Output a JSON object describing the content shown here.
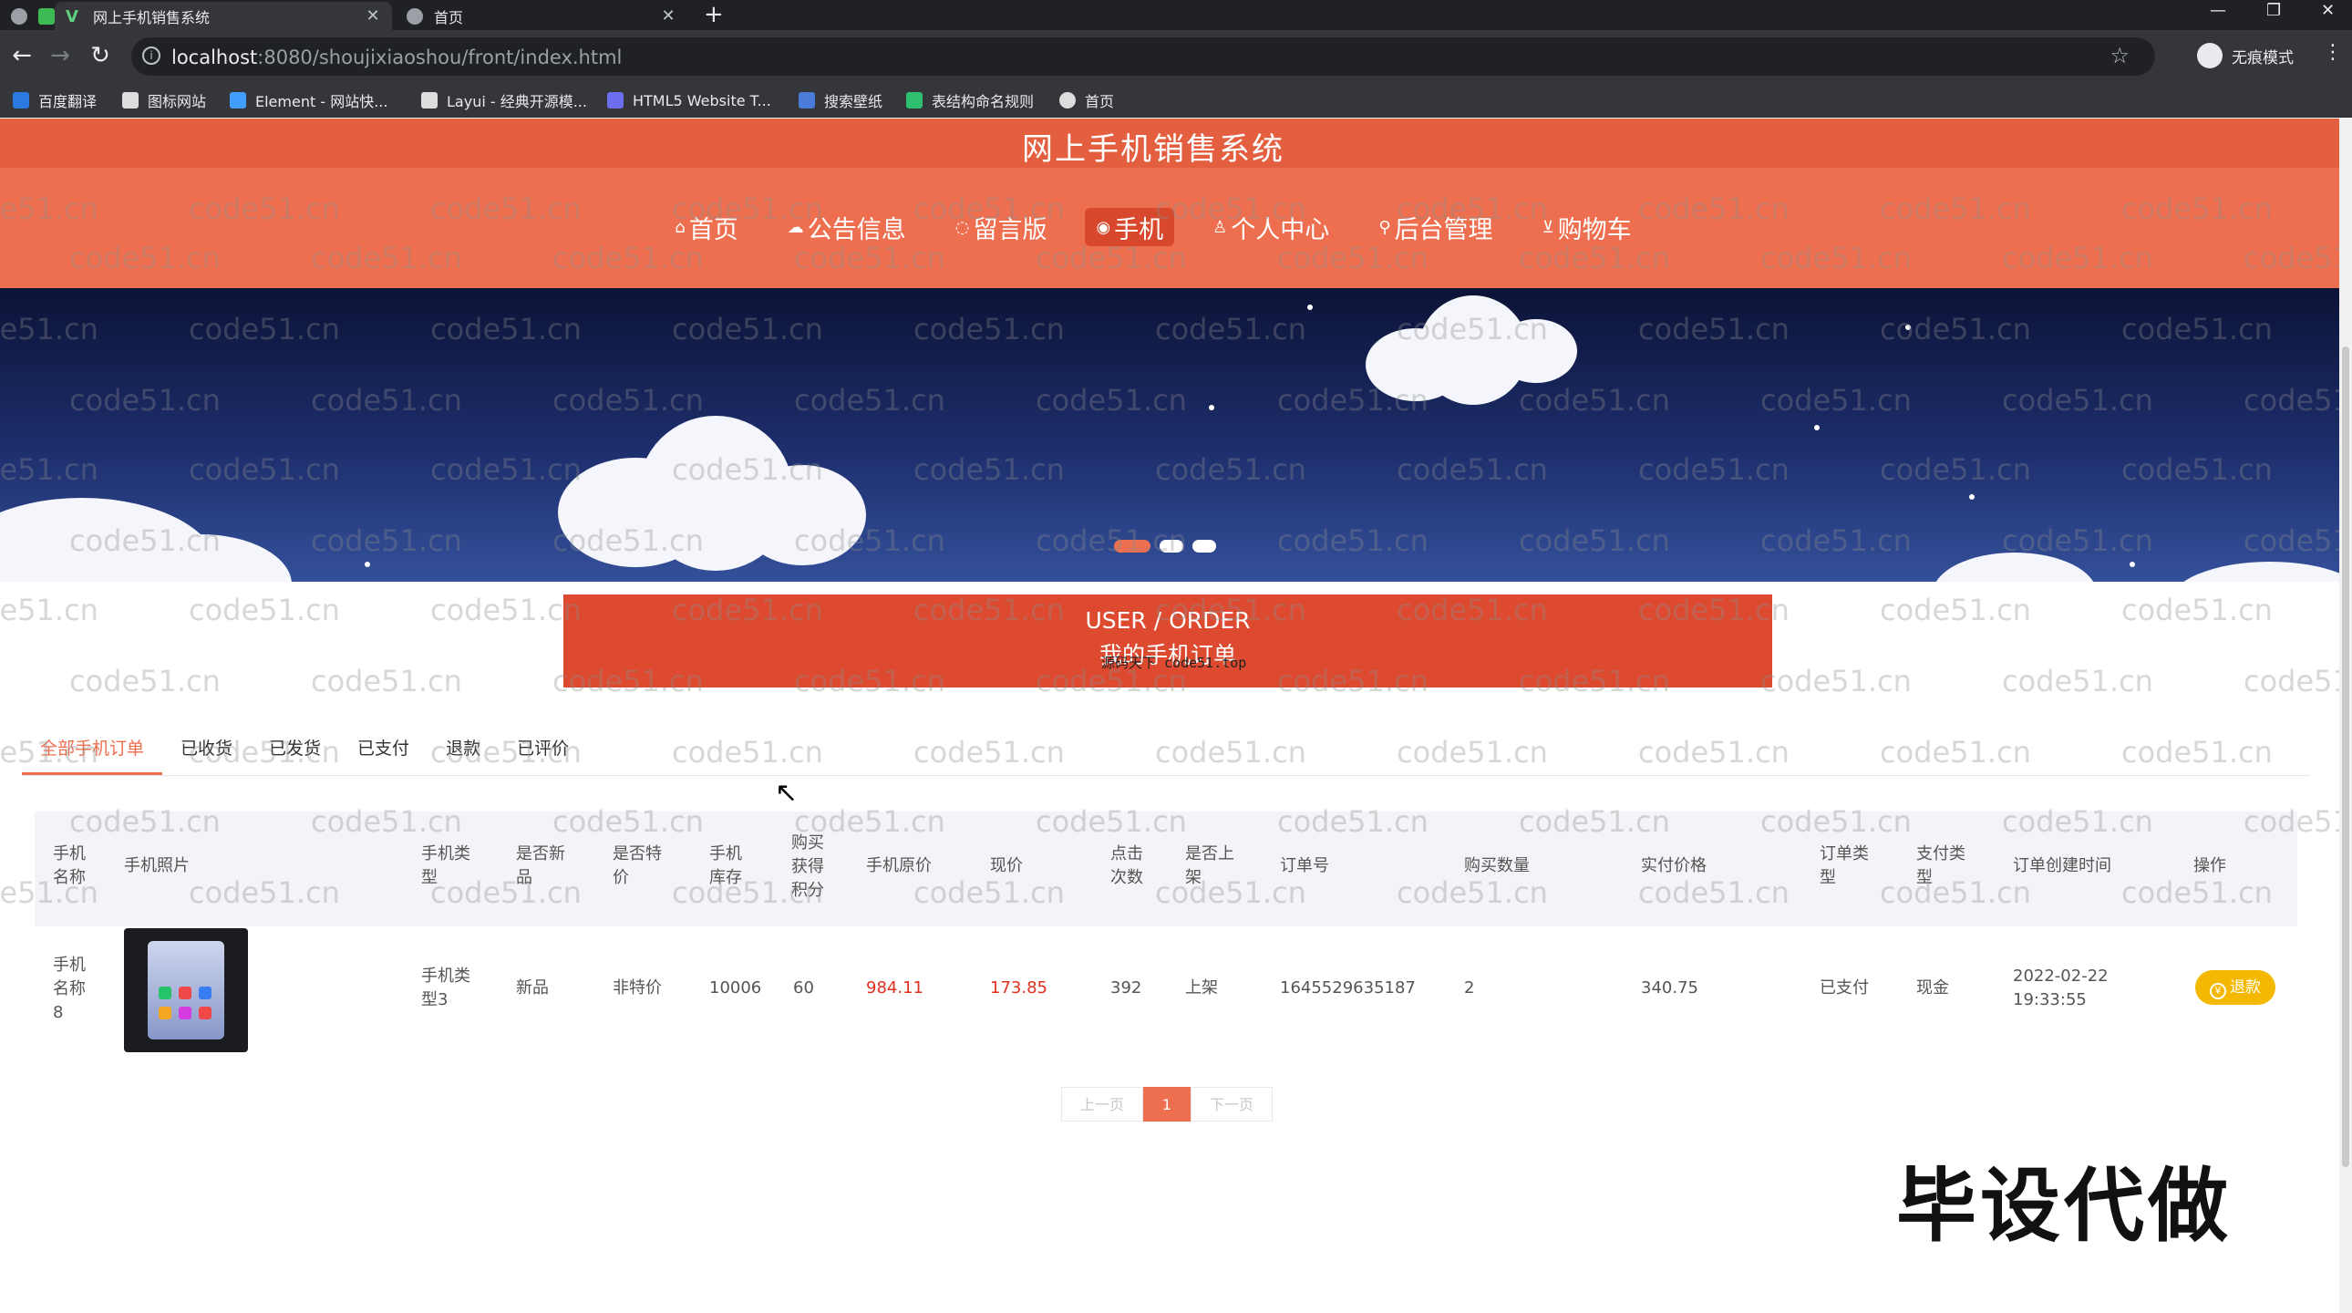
{
  "browser": {
    "tabs": [
      {
        "title": "网上手机销售系统"
      },
      {
        "title": "首页"
      }
    ],
    "url_host": "localhost",
    "url_rest": ":8080/shoujixiaoshou/front/index.html",
    "profile_label": "无痕模式",
    "bookmarks": [
      {
        "label": "百度翻译",
        "color": "#2a7ae2"
      },
      {
        "label": "图标网站",
        "color": "#dddddd"
      },
      {
        "label": "Element - 网站快...",
        "color": "#409eff"
      },
      {
        "label": "Layui - 经典开源模...",
        "color": "#dddddd"
      },
      {
        "label": "HTML5 Website T...",
        "color": "#6d6df0"
      },
      {
        "label": "搜索壁纸",
        "color": "#4a7bd8"
      },
      {
        "label": "表结构命名规则",
        "color": "#2fbf71"
      },
      {
        "label": "首页",
        "color": "#dddddd"
      }
    ]
  },
  "site": {
    "title": "网上手机销售系统",
    "nav": [
      {
        "label": "首页",
        "icon": "home-icon",
        "glyph": "⌂"
      },
      {
        "label": "公告信息",
        "icon": "notice-icon",
        "glyph": "☁"
      },
      {
        "label": "留言版",
        "icon": "message-icon",
        "glyph": "◌"
      },
      {
        "label": "手机",
        "icon": "phone-icon",
        "glyph": "◉",
        "active": true
      },
      {
        "label": "个人中心",
        "icon": "user-icon",
        "glyph": "♙"
      },
      {
        "label": "后台管理",
        "icon": "link-icon",
        "glyph": "⚲"
      },
      {
        "label": "购物车",
        "icon": "cart-icon",
        "glyph": "⊻"
      }
    ],
    "accent": "#ee6f4f"
  },
  "order": {
    "heading_en": "USER / ORDER",
    "heading_cn": "我的手机订单",
    "watermark_small": "源码天下 code51.top",
    "tabs": [
      "全部手机订单",
      "已收货",
      "已发货",
      "已支付",
      "退款",
      "已评价"
    ],
    "columns": [
      "手机名称",
      "手机照片",
      "手机类型",
      "是否新品",
      "是否特价",
      "手机库存",
      "购买获得积分",
      "手机原价",
      "现价",
      "点击次数",
      "是否上架",
      "订单号",
      "购买数量",
      "实付价格",
      "订单类型",
      "支付类型",
      "订单创建时间",
      "操作"
    ],
    "row": {
      "name": "手机名称8",
      "type": "手机类型3",
      "is_new": "新品",
      "is_special": "非特价",
      "stock": "10006",
      "points": "60",
      "original_price": "984.11",
      "price": "173.85",
      "clicks": "392",
      "on_shelf": "上架",
      "order_no": "1645529635187",
      "quantity": "2",
      "paid": "340.75",
      "order_type": "已支付",
      "pay_type": "现金",
      "created_date": "2022-02-22",
      "created_time": "19:33:55",
      "action": "退款"
    },
    "pager": {
      "prev": "上一页",
      "current": "1",
      "next": "下一页"
    }
  },
  "overlay": {
    "watermark": "code51.cn",
    "stamp": "毕设代做"
  }
}
